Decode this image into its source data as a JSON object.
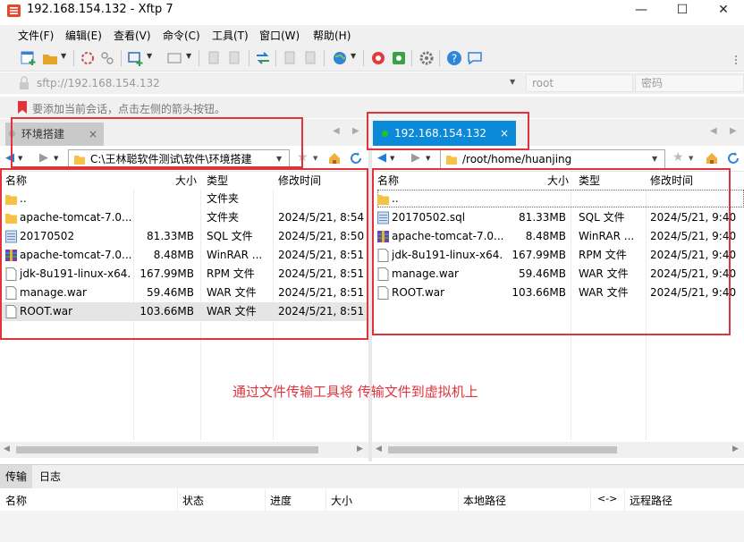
{
  "window": {
    "title": "192.168.154.132 - Xftp 7",
    "min_glyph": "—",
    "max_glyph": "☐",
    "close_glyph": "✕"
  },
  "menu": [
    "文件(F)",
    "编辑(E)",
    "查看(V)",
    "命令(C)",
    "工具(T)",
    "窗口(W)",
    "帮助(H)"
  ],
  "address": {
    "url_placeholder": "sftp://192.168.154.132",
    "user_placeholder": "root",
    "pass_placeholder": "密码"
  },
  "infobar": {
    "text": "要添加当前会话，点击左侧的箭头按钮。"
  },
  "tabs": {
    "local": {
      "label": "环境搭建",
      "close": "×"
    },
    "remote": {
      "label": "192.168.154.132",
      "close": "×"
    }
  },
  "local": {
    "path": "C:\\王林聪软件测试\\软件\\环境搭建",
    "columns": {
      "name": "名称",
      "size": "大小",
      "type": "类型",
      "mtime": "修改时间"
    },
    "rows": [
      {
        "name": "..",
        "size": "",
        "type": "文件夹",
        "mtime": "",
        "icon": "folder"
      },
      {
        "name": "apache-tomcat-7.0....",
        "size": "",
        "type": "文件夹",
        "mtime": "2024/5/21, 8:54",
        "icon": "folder"
      },
      {
        "name": "20170502",
        "size": "81.33MB",
        "type": "SQL 文件",
        "mtime": "2024/5/21, 8:50",
        "icon": "sql"
      },
      {
        "name": "apache-tomcat-7.0....",
        "size": "8.48MB",
        "type": "WinRAR ...",
        "mtime": "2024/5/21, 8:51",
        "icon": "rar"
      },
      {
        "name": "jdk-8u191-linux-x64...",
        "size": "167.99MB",
        "type": "RPM 文件",
        "mtime": "2024/5/21, 8:51",
        "icon": "file"
      },
      {
        "name": "manage.war",
        "size": "59.46MB",
        "type": "WAR 文件",
        "mtime": "2024/5/21, 8:51",
        "icon": "file"
      },
      {
        "name": "ROOT.war",
        "size": "103.66MB",
        "type": "WAR 文件",
        "mtime": "2024/5/21, 8:51",
        "icon": "file"
      }
    ]
  },
  "remote": {
    "path": "/root/home/huanjing",
    "columns": {
      "name": "名称",
      "size": "大小",
      "type": "类型",
      "mtime": "修改时间"
    },
    "rows": [
      {
        "name": "..",
        "size": "",
        "type": "",
        "mtime": "",
        "icon": "folder"
      },
      {
        "name": "20170502.sql",
        "size": "81.33MB",
        "type": "SQL 文件",
        "mtime": "2024/5/21, 9:40",
        "icon": "sql"
      },
      {
        "name": "apache-tomcat-7.0....",
        "size": "8.48MB",
        "type": "WinRAR ...",
        "mtime": "2024/5/21, 9:40",
        "icon": "rar"
      },
      {
        "name": "jdk-8u191-linux-x64...",
        "size": "167.99MB",
        "type": "RPM 文件",
        "mtime": "2024/5/21, 9:40",
        "icon": "file"
      },
      {
        "name": "manage.war",
        "size": "59.46MB",
        "type": "WAR 文件",
        "mtime": "2024/5/21, 9:40",
        "icon": "file"
      },
      {
        "name": "ROOT.war",
        "size": "103.66MB",
        "type": "WAR 文件",
        "mtime": "2024/5/21, 9:40",
        "icon": "file"
      }
    ]
  },
  "annotation": {
    "text": "通过文件传输工具将 传输文件到虚拟机上",
    "color": "#e0333b"
  },
  "transfer": {
    "tabs": [
      "传输",
      "日志"
    ],
    "columns": {
      "name": "名称",
      "status": "状态",
      "progress": "进度",
      "size": "大小",
      "local_path": "本地路径",
      "direction": "<->",
      "remote_path": "远程路径"
    }
  },
  "colors": {
    "accent": "#0a8ad8",
    "annotation_red": "#e0333b",
    "selected_row": "#e5e5e5",
    "connected_dot": "#21c521"
  }
}
